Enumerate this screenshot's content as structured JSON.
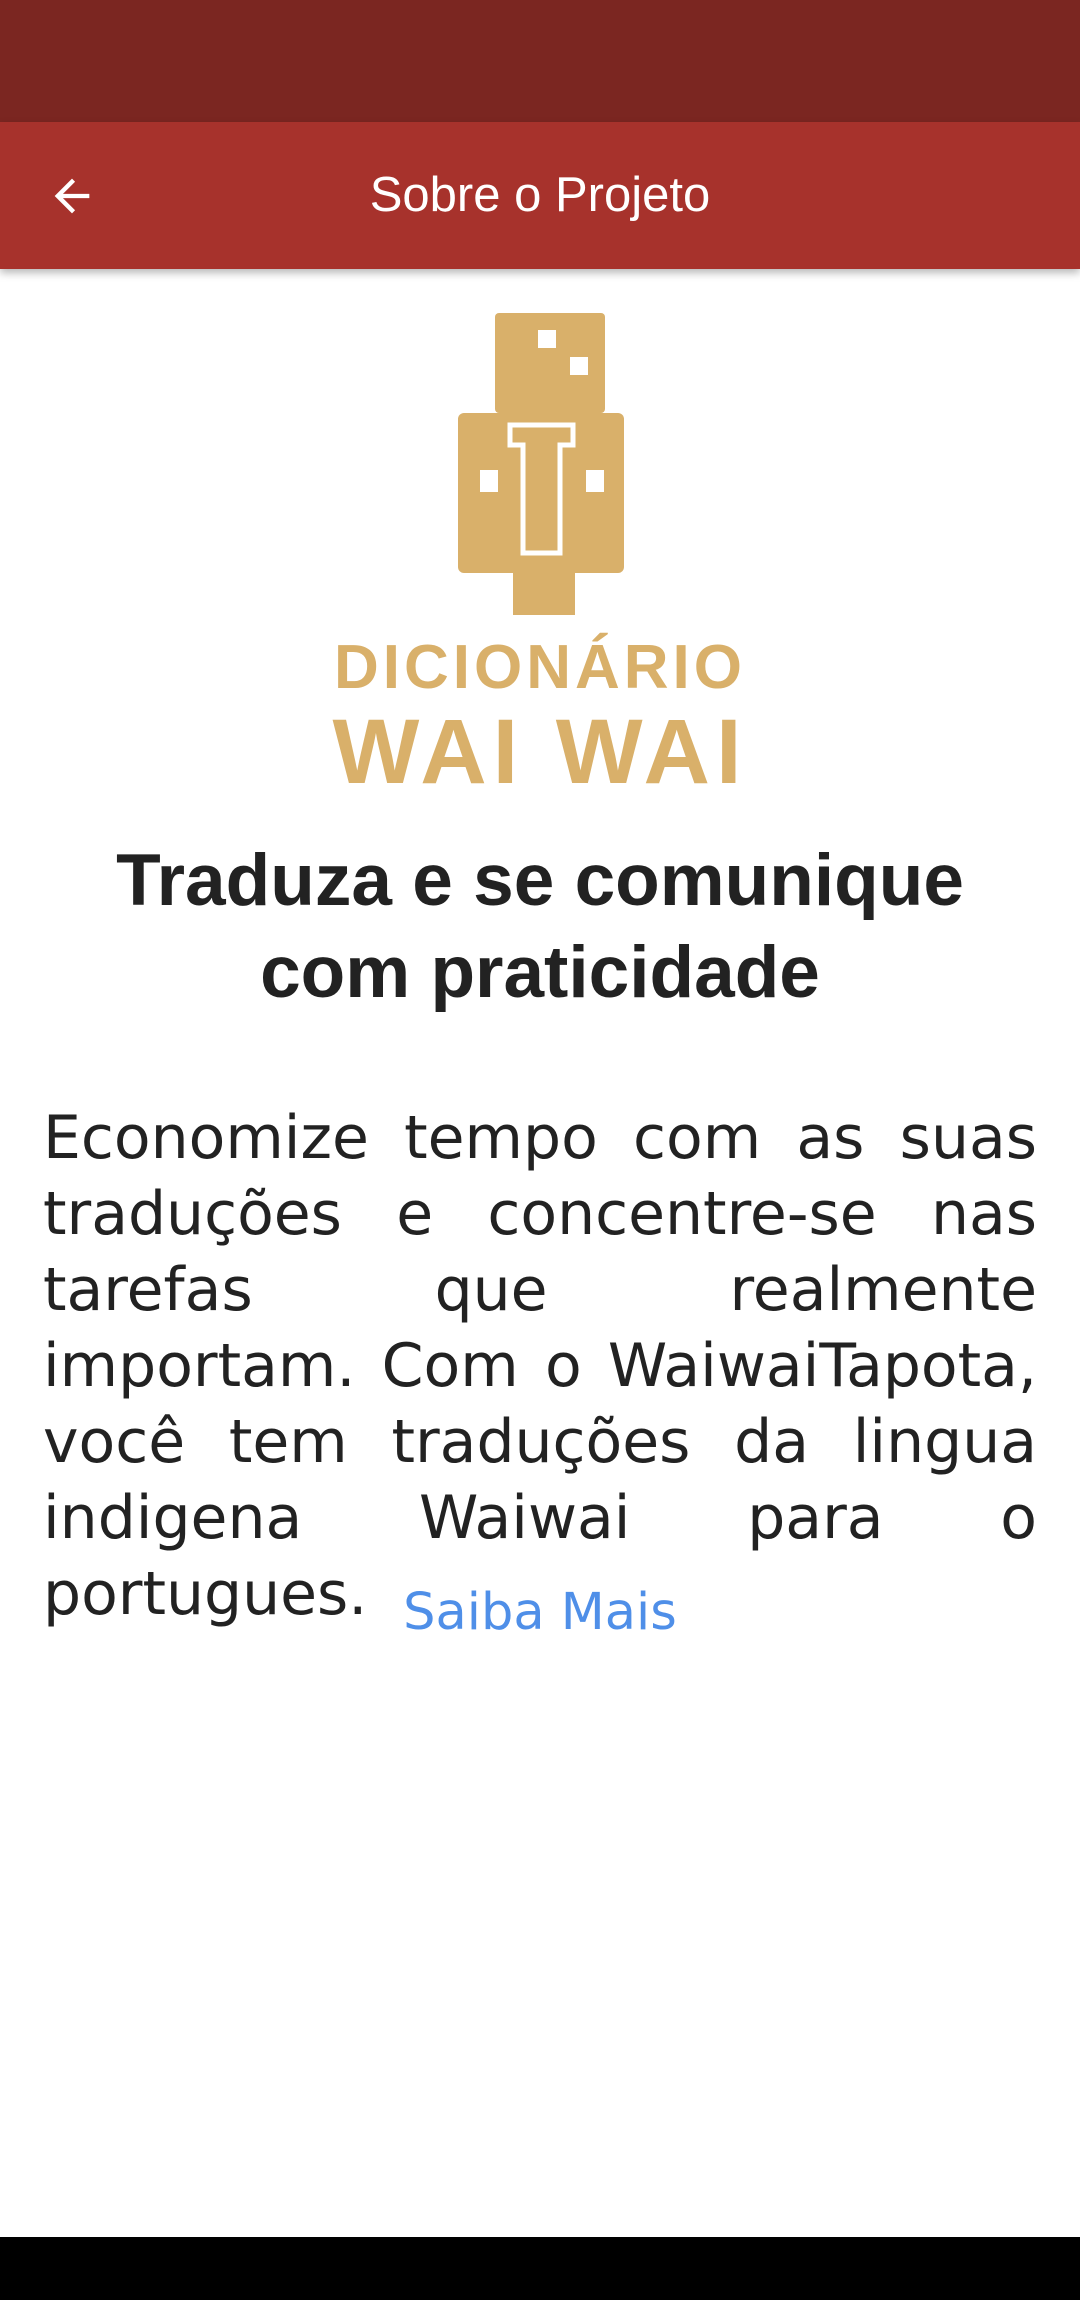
{
  "app_bar": {
    "title": "Sobre o Projeto",
    "back_icon": "arrow-left-icon"
  },
  "logo": {
    "line1": "DICIONÁRIO",
    "line2": "WAI WAI",
    "color": "#d9b06a"
  },
  "content": {
    "headline": "Traduza e se comunique com praticidade",
    "description": "Economize tempo com as suas traduções e concentre-se nas tarefas que realmente importam. Com o WaiwaiTapota, você tem traduções da lingua indigena Waiwai para o portugues.",
    "link_label": "Saiba Mais"
  },
  "colors": {
    "status_bar": "#7b2621",
    "app_bar": "#a7322c",
    "link": "#4f8fe8"
  }
}
